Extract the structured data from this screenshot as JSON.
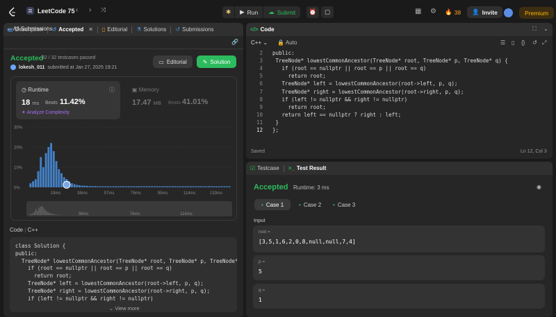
{
  "topbar": {
    "title": "LeetCode 75",
    "run_label": "Run",
    "submit_label": "Submit",
    "streak": "38",
    "invite_label": "Invite",
    "premium_label": "Premium"
  },
  "left_tabs": [
    {
      "label": "Description",
      "icon": "document-icon"
    },
    {
      "label": "Accepted",
      "icon": "history-icon",
      "selected": true
    },
    {
      "label": "Editorial",
      "icon": "book-icon"
    },
    {
      "label": "Solutions",
      "icon": "flask-icon"
    },
    {
      "label": "Submissions",
      "icon": "history-icon"
    }
  ],
  "submission": {
    "back_label": "All Submissions",
    "status": "Accepted",
    "passed": "32 / 32 testcases passed",
    "user": "lokesh_011",
    "submitted_at": "submitted at Jan 27, 2025 19:21",
    "editorial_btn": "Editorial",
    "solution_btn": "Solution"
  },
  "runtime": {
    "title": "Runtime",
    "value": "18",
    "unit": "ms",
    "beats_label": "Beats",
    "beats_pct": "11.42%",
    "analyze_label": "Analyze Complexity"
  },
  "memory": {
    "title": "Memory",
    "value": "17.47",
    "unit": "MB",
    "beats_label": "Beats",
    "beats_pct": "41.01%"
  },
  "chart_data": {
    "type": "bar",
    "yticks": [
      "30%",
      "20%",
      "10%",
      "0%"
    ],
    "ylim": [
      0,
      30
    ],
    "xticks": [
      "19ms",
      "38ms",
      "57ms",
      "76ms",
      "95ms",
      "114ms",
      "133ms"
    ],
    "mini_xticks": [
      "38ms",
      "76ms",
      "114ms"
    ],
    "values": [
      2,
      3,
      4,
      8,
      15,
      10,
      17,
      20,
      22,
      18,
      13,
      9,
      7,
      5,
      4,
      3,
      2,
      1.5,
      1.2,
      1,
      0.8,
      0.8,
      0.7,
      0.6,
      0.6,
      0.6,
      0.5,
      0.5,
      0.5,
      0.5,
      0.5,
      0.5,
      0.5,
      0.5,
      0.5,
      0.5,
      0.5,
      0.5,
      0.5,
      0.5,
      0.5,
      0.5,
      0.5,
      0.5,
      0.5,
      0.5,
      0.5,
      0.5,
      0.5,
      0.5,
      0.5,
      0.5,
      0.5,
      0.5,
      0.5,
      0.5,
      0.5,
      0.5,
      0.5,
      0.5,
      0.5,
      0.5,
      0.5,
      0.5,
      0.5,
      0.5,
      0.5,
      0.5,
      0.5,
      0.5,
      0.5,
      0.5,
      0.5,
      0.5,
      0.5,
      0.5,
      0.5,
      0.5
    ],
    "highlight_index": 14,
    "accent": "#4a90e2"
  },
  "code_section": {
    "label": "Code",
    "lang": "C++",
    "lines": [
      "class Solution {",
      "public:",
      "  TreeNode* lowestCommonAncestor(TreeNode* root, TreeNode* p, TreeNode*",
      "    if (root == nullptr || root == p || root == q)",
      "      return root;",
      "    TreeNode* left = lowestCommonAncestor(root->left, p, q);",
      "    TreeNode* right = lowestCommonAncestor(root->right, p, q);",
      "    if (left != nullptr && right != nullptr)"
    ],
    "view_more": "View more"
  },
  "editor": {
    "title": "Code",
    "lang": "C++",
    "auto": "Auto",
    "line_numbers": [
      "2",
      "3",
      "4",
      "5",
      "6",
      "7",
      "8",
      "9",
      "10",
      "11",
      "12"
    ],
    "lines": [
      "public:",
      " TreeNode* lowestCommonAncestor(TreeNode* root, TreeNode* p, TreeNode* q) {",
      "   if (root == nullptr || root == p || root == q)",
      "     return root;",
      "   TreeNode* left = lowestCommonAncestor(root->left, p, q);",
      "   TreeNode* right = lowestCommonAncestor(root->right, p, q);",
      "   if (left != nullptr && right != nullptr)",
      "     return root;",
      "   return left == nullptr ? right : left;",
      " }",
      "};"
    ],
    "saved": "Saved",
    "position": "Ln 12, Col 3"
  },
  "testpanel": {
    "testcase_tab": "Testcase",
    "result_tab": "Test Result",
    "status": "Accepted",
    "runtime": "Runtime: 3 ms",
    "cases": [
      "Case 1",
      "Case 2",
      "Case 3"
    ],
    "input_label": "Input",
    "vars": [
      {
        "name": "root =",
        "value": "[3,5,1,6,2,0,8,null,null,7,4]"
      },
      {
        "name": "p =",
        "value": "5"
      },
      {
        "name": "q =",
        "value": "1"
      }
    ]
  }
}
